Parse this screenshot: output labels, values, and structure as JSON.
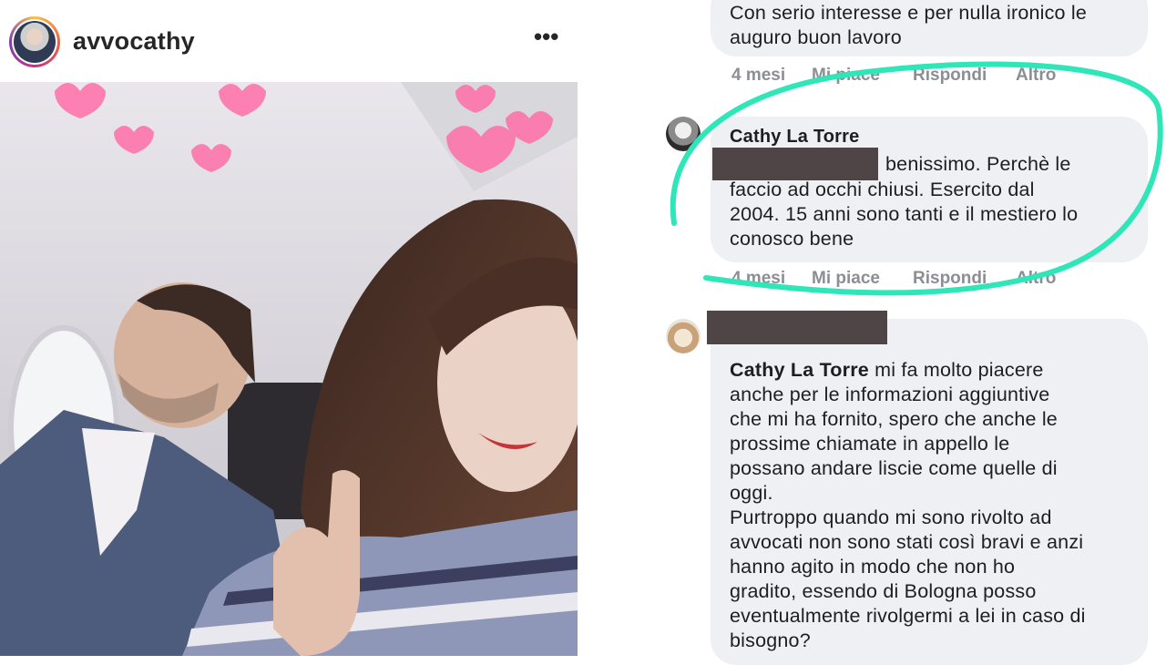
{
  "post": {
    "username": "avvocathy",
    "more_icon": "•••"
  },
  "comments": [
    {
      "lines": [
        "Con serio interesse e per nulla ironico le",
        "auguro buon lavoro"
      ],
      "actions": {
        "time": "4 mesi",
        "like": "Mi piace",
        "reply": "Rispondi",
        "more": "Altro"
      }
    },
    {
      "author": "Cathy La Torre",
      "first_line": "benissimo. Perchè le",
      "lines": [
        "faccio ad occhi chiusi. Esercito dal",
        "2004. 15 anni sono tanti e il mestiero lo",
        "conosco bene"
      ],
      "actions": {
        "time": "4 mesi",
        "like": "Mi piace",
        "reply": "Rispondi",
        "more": "Altro"
      }
    },
    {
      "mention": "Cathy La Torre",
      "first_line": " mi fa molto piacere",
      "lines": [
        "anche per le informazioni aggiuntive",
        "che mi ha fornito, spero che anche le",
        "prossime chiamate in appello le",
        "possano andare liscie come quelle di",
        "oggi.",
        "Purtroppo quando mi sono rivolto ad",
        "avvocati non sono stati così bravi e anzi",
        "hanno agito in modo che non ho",
        "gradito, essendo di Bologna posso",
        "eventualmente rivolgermi a lei in caso di",
        "bisogno?"
      ]
    }
  ],
  "colors": {
    "highlight": "#2ee6b8",
    "redaction": "#4f4446",
    "bubble": "#eff0f3"
  }
}
